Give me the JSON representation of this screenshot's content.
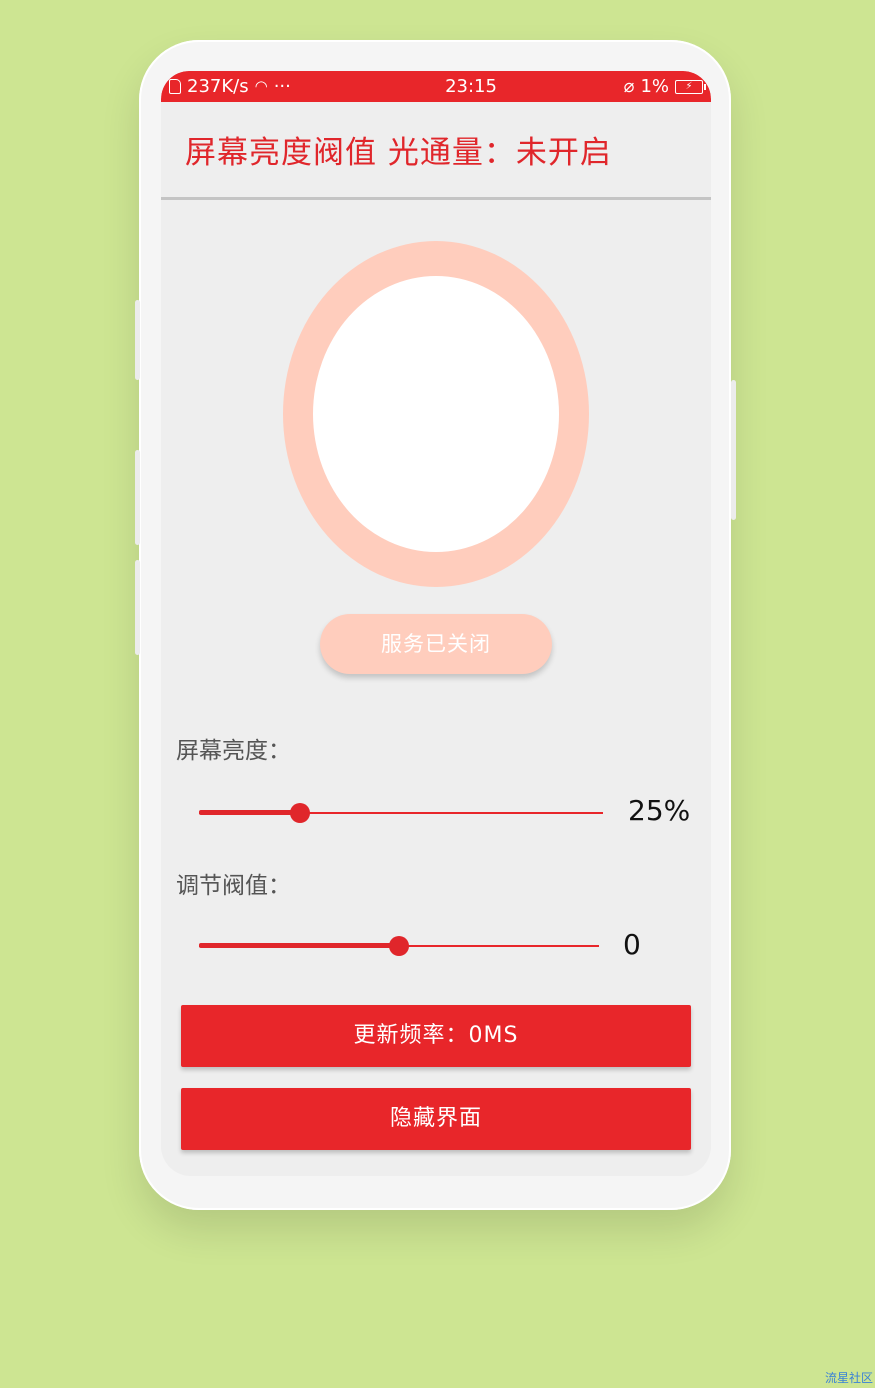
{
  "status_bar": {
    "network_speed": "237K/s",
    "more": "···",
    "time": "23:15",
    "battery": "1%"
  },
  "header": {
    "title": "屏幕亮度阀值 光通量：未开启"
  },
  "service": {
    "button_label": "服务已关闭"
  },
  "brightness": {
    "label": "屏幕亮度：",
    "value_text": "25%",
    "level": 0.25
  },
  "threshold": {
    "label": "调节阀值：",
    "value_text": "0",
    "level": 0.5
  },
  "buttons": {
    "update_label": "更新频率：0MS",
    "hide_label": "隐藏界面"
  },
  "watermark": "流星社区",
  "colors": {
    "accent": "#e8262a",
    "ring": "#ffcdbd",
    "background": "#cde592"
  }
}
